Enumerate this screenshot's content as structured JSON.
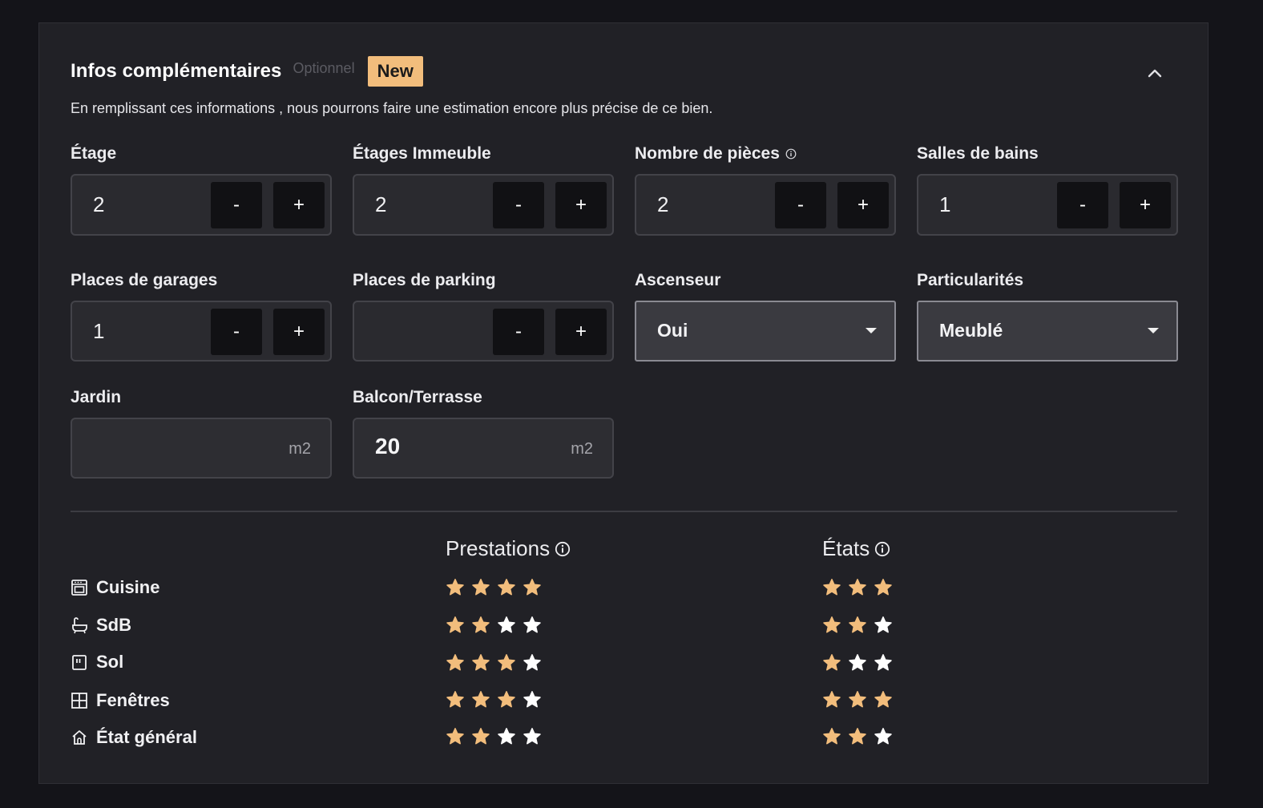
{
  "header": {
    "title": "Infos complémentaires",
    "optional": "Optionnel",
    "badge": "New",
    "description": "En remplissant ces informations , nous pourrons faire une estimation encore plus précise de ce bien."
  },
  "fields": {
    "etage": {
      "label": "Étage",
      "value": "2"
    },
    "etages_immeuble": {
      "label": "Étages Immeuble",
      "value": "2"
    },
    "nombre_pieces": {
      "label": "Nombre de pièces",
      "value": "2"
    },
    "salles_bains": {
      "label": "Salles de bains",
      "value": "1"
    },
    "places_garages": {
      "label": "Places de garages",
      "value": "1"
    },
    "places_parking": {
      "label": "Places de parking",
      "value": ""
    },
    "ascenseur": {
      "label": "Ascenseur",
      "value": "Oui"
    },
    "particularites": {
      "label": "Particularités",
      "value": "Meublé"
    },
    "jardin": {
      "label": "Jardin",
      "value": "",
      "unit": "m2"
    },
    "balcon": {
      "label": "Balcon/Terrasse",
      "value": "20",
      "unit": "m2"
    }
  },
  "stepper": {
    "minus": "-",
    "plus": "+"
  },
  "ratings": {
    "columns": {
      "prestations": "Prestations",
      "etats": "États"
    },
    "max_stars": 4,
    "rows": [
      {
        "label": "Cuisine",
        "icon": "oven-icon",
        "prestations": 4,
        "etats": 3
      },
      {
        "label": "SdB",
        "icon": "bathtub-icon",
        "prestations": 2,
        "etats": 2
      },
      {
        "label": "Sol",
        "icon": "floor-icon",
        "prestations": 3,
        "etats": 1
      },
      {
        "label": "Fenêtres",
        "icon": "window-icon",
        "prestations": 3,
        "etats": 3
      },
      {
        "label": "État général",
        "icon": "house-icon",
        "prestations": 2,
        "etats": 2
      }
    ]
  },
  "colors": {
    "accent": "#f2bd7c",
    "star_filled": "#f2bd7c",
    "star_empty": "#ffffff",
    "panel_bg": "#212126"
  }
}
